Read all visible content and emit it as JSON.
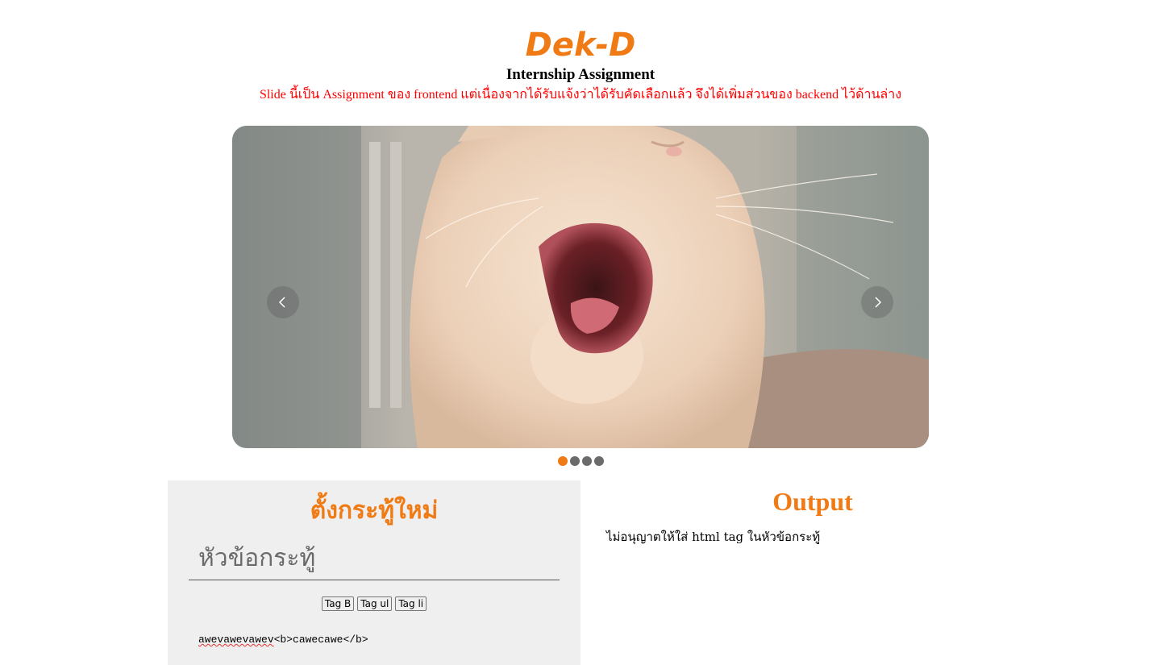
{
  "header": {
    "logo_text": "Dek-D",
    "subtitle": "Internship Assignment",
    "note": "Slide นี้เป็น Assignment ของ frontend แต่เนื่องจากได้รับแจ้งว่าได้รับคัดเลือกแล้ว จึงได้เพิ่มส่วนของ backend ไว้ด้านล่าง"
  },
  "slider": {
    "image_subject": "yawning white cat",
    "slide_count": 4,
    "active_slide": 1
  },
  "new_topic": {
    "title": "ตั้งกระทู้ใหม่",
    "topic_placeholder": "หัวข้อกระทู้",
    "tag_buttons": [
      "Tag B",
      "Tag ul",
      "Tag li"
    ],
    "editor_misspelled": "awevawevawev",
    "editor_rest": "<b>cawecawe</b>"
  },
  "output": {
    "title": "Output",
    "warning": "ไม่อนุญาตให้ใส่ html tag ในหัวข้อกระทู้"
  },
  "colors": {
    "accent": "#f07a14",
    "note": "#ff0000",
    "panel_bg": "#efefef"
  }
}
